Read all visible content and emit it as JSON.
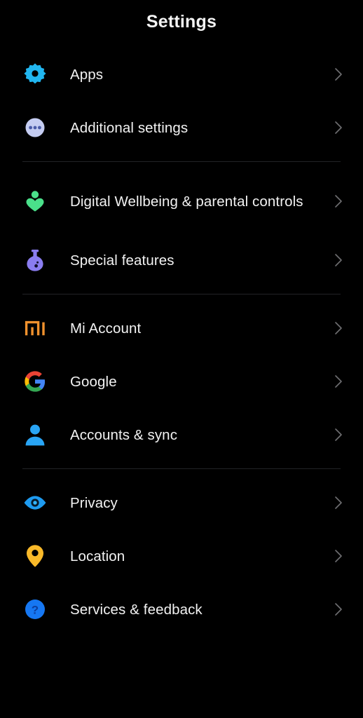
{
  "header": {
    "title": "Settings"
  },
  "colors": {
    "background": "#000000",
    "text": "#f2f2f2",
    "divider": "#222326",
    "chevron": "#6d6d70",
    "gear_blue": "#21b6f0",
    "dots_circle": "#c5cdf2",
    "dots_dot": "#4a5ba8",
    "wellbeing_green": "#4ae08a",
    "flask_purple": "#8a7df0",
    "mi_orange": "#f0912d",
    "google_red": "#ea4335",
    "google_yellow": "#fbbc05",
    "google_green": "#34a853",
    "google_blue": "#4285f4",
    "person_blue": "#29a5f5",
    "eye_blue": "#1e9bf0",
    "pin_amber": "#f9b929",
    "help_blue": "#1677f2"
  },
  "groups": [
    {
      "id": "group-apps",
      "items": [
        {
          "label": "Apps",
          "icon": "gear-icon",
          "name": "settings-item-apps"
        },
        {
          "label": "Additional settings",
          "icon": "three-dots-circle-icon",
          "name": "settings-item-additional-settings"
        }
      ]
    },
    {
      "id": "group-wellbeing",
      "items": [
        {
          "label": "Digital Wellbeing & parental controls",
          "icon": "digital-wellbeing-icon",
          "name": "settings-item-digital-wellbeing"
        },
        {
          "label": "Special features",
          "icon": "flask-icon",
          "name": "settings-item-special-features"
        }
      ]
    },
    {
      "id": "group-accounts",
      "items": [
        {
          "label": "Mi Account",
          "icon": "mi-logo-icon",
          "name": "settings-item-mi-account"
        },
        {
          "label": "Google",
          "icon": "google-logo-icon",
          "name": "settings-item-google"
        },
        {
          "label": "Accounts & sync",
          "icon": "person-icon",
          "name": "settings-item-accounts-sync"
        }
      ]
    },
    {
      "id": "group-privacy",
      "items": [
        {
          "label": "Privacy",
          "icon": "eye-icon",
          "name": "settings-item-privacy"
        },
        {
          "label": "Location",
          "icon": "map-pin-icon",
          "name": "settings-item-location"
        },
        {
          "label": "Services & feedback",
          "icon": "question-mark-circle-icon",
          "name": "settings-item-services-feedback"
        }
      ]
    }
  ],
  "chevron_glyph": "chevron-right-icon"
}
